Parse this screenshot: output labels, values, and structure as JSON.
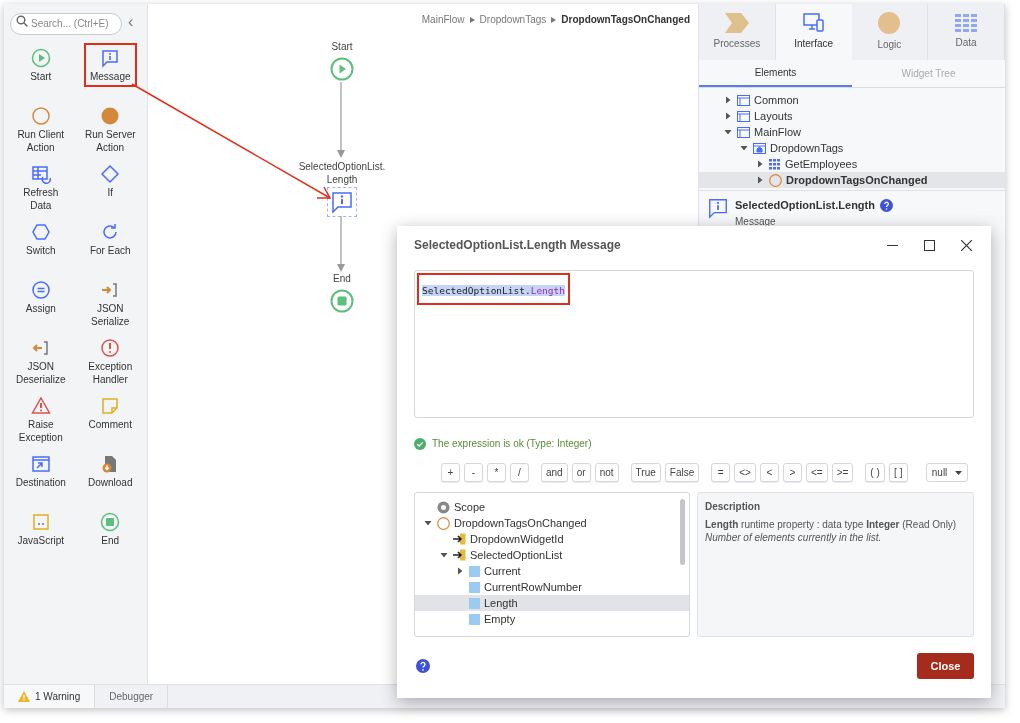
{
  "toolbox": {
    "search": {
      "placeholder": "Search... (Ctrl+E)"
    },
    "collapse": "‹",
    "tools": [
      {
        "label": "Start",
        "annotated": false
      },
      {
        "label": "Message",
        "annotated": true
      },
      {
        "label": "Run Client Action",
        "annotated": false
      },
      {
        "label": "Run Server Action",
        "annotated": false
      },
      {
        "label": "Refresh Data",
        "annotated": false
      },
      {
        "label": "If",
        "annotated": false
      },
      {
        "label": "Switch",
        "annotated": false
      },
      {
        "label": "For Each",
        "annotated": false
      },
      {
        "label": "Assign",
        "annotated": false
      },
      {
        "label": "JSON Serialize",
        "annotated": false
      },
      {
        "label": "JSON Deserialize",
        "annotated": false
      },
      {
        "label": "Exception Handler",
        "annotated": false
      },
      {
        "label": "Raise Exception",
        "annotated": false
      },
      {
        "label": "Comment",
        "annotated": false
      },
      {
        "label": "Destination",
        "annotated": false
      },
      {
        "label": "Download",
        "annotated": false
      },
      {
        "label": "JavaScript",
        "annotated": false
      },
      {
        "label": "End",
        "annotated": false
      }
    ]
  },
  "breadcrumb": [
    "MainFlow",
    "DropdownTags",
    "DropdownTagsOnChanged"
  ],
  "flow": {
    "nodes": [
      {
        "kind": "start",
        "label": "Start",
        "selected": false
      },
      {
        "kind": "message",
        "label": "SelectedOptionList. Length",
        "selected": true
      },
      {
        "kind": "end",
        "label": "End",
        "selected": false
      }
    ]
  },
  "right_panel": {
    "tabs": [
      {
        "label": "Processes",
        "selected": false
      },
      {
        "label": "Interface",
        "selected": true
      },
      {
        "label": "Logic",
        "selected": false
      },
      {
        "label": "Data",
        "selected": false
      }
    ],
    "subtabs": [
      {
        "label": "Elements",
        "selected": true
      },
      {
        "label": "Widget Tree",
        "selected": false
      }
    ],
    "tree": [
      {
        "label": "Common",
        "kind": "folder",
        "expanded": false,
        "selected": false
      },
      {
        "label": "Layouts",
        "kind": "folder",
        "expanded": false,
        "selected": false
      },
      {
        "label": "MainFlow",
        "kind": "folder",
        "expanded": true,
        "selected": false,
        "children": [
          {
            "label": "DropdownTags",
            "kind": "screen",
            "expanded": true,
            "selected": false,
            "children": [
              {
                "label": "GetEmployees",
                "kind": "aggregate",
                "expanded": false,
                "selected": false
              },
              {
                "label": "DropdownTagsOnChanged",
                "kind": "action",
                "expanded": false,
                "selected": true
              }
            ]
          }
        ]
      }
    ],
    "selection": {
      "title": "SelectedOptionList.Length",
      "type": "Message"
    }
  },
  "status_bar": [
    {
      "label": "1 Warning",
      "selected": true,
      "kind": "warning"
    },
    {
      "label": "Debugger",
      "selected": false,
      "kind": "plain"
    }
  ],
  "dialog": {
    "title": "SelectedOptionList.Length Message",
    "expression": {
      "object_part": "SelectedOptionList.",
      "property_part": "Length",
      "selected": true,
      "annotated": true
    },
    "status": "The expression is ok (Type: Integer)",
    "operator_groups": [
      [
        "+",
        "-",
        "*",
        "/"
      ],
      [
        "and",
        "or",
        "not"
      ],
      [
        "True",
        "False"
      ],
      [
        "=",
        "<>",
        "<",
        ">",
        "<=",
        ">="
      ],
      [
        "( )",
        "[ ]"
      ]
    ],
    "null_dropdown": "null",
    "scope_tree": [
      {
        "label": "Scope",
        "kind": "scope",
        "selected": false
      },
      {
        "label": "DropdownTagsOnChanged",
        "kind": "action",
        "expanded": true,
        "selected": false,
        "children": [
          {
            "label": "DropdownWidgetId",
            "kind": "input",
            "selected": false
          },
          {
            "label": "SelectedOptionList",
            "kind": "input",
            "expanded": true,
            "selected": false,
            "children": [
              {
                "label": "Current",
                "kind": "attribute",
                "expanded": false,
                "selected": false
              },
              {
                "label": "CurrentRowNumber",
                "kind": "attribute",
                "selected": false
              },
              {
                "label": "Length",
                "kind": "attribute",
                "selected": true
              },
              {
                "label": "Empty",
                "kind": "attribute",
                "selected": false
              }
            ]
          }
        ]
      }
    ],
    "description": {
      "heading": "Description",
      "text": "**Length** runtime property : data type **Integer** (Read Only)",
      "note": "Number of elements currently in the list."
    },
    "close_button": "Close"
  }
}
